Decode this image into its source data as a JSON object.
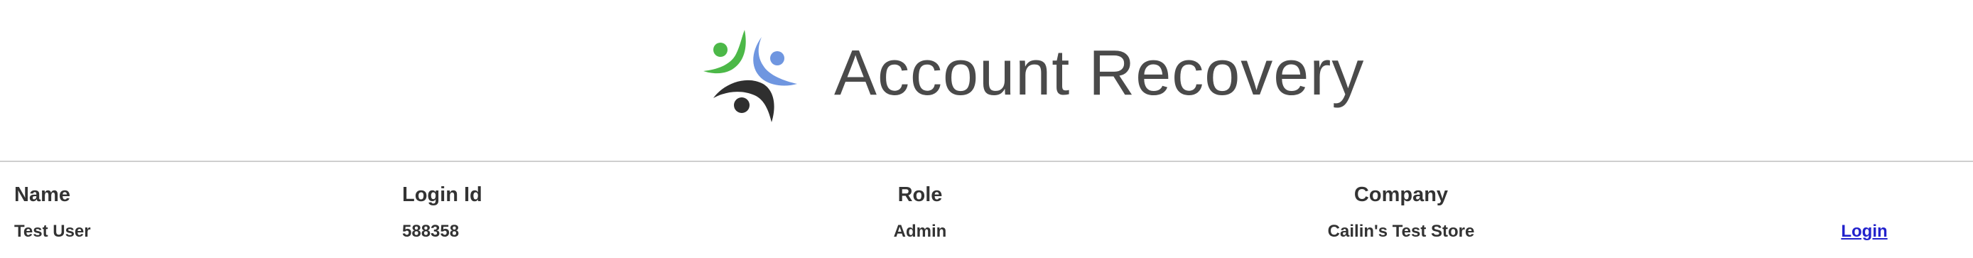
{
  "header": {
    "title": "Account Recovery",
    "logo_icon": "people-circle-logo-icon",
    "logo_colors": {
      "green": "#4cb848",
      "blue": "#6f96e0",
      "dark": "#2f2f2f"
    }
  },
  "table": {
    "columns": [
      "Name",
      "Login Id",
      "Role",
      "Company"
    ],
    "rows": [
      {
        "name": "Test User",
        "login_id": "588358",
        "role": "Admin",
        "company": "Cailin's Test Store",
        "action": "Login"
      }
    ]
  },
  "colors": {
    "link": "#2222cc",
    "divider": "#cfcfcf",
    "title": "#4a4a4a",
    "text": "#333333"
  }
}
